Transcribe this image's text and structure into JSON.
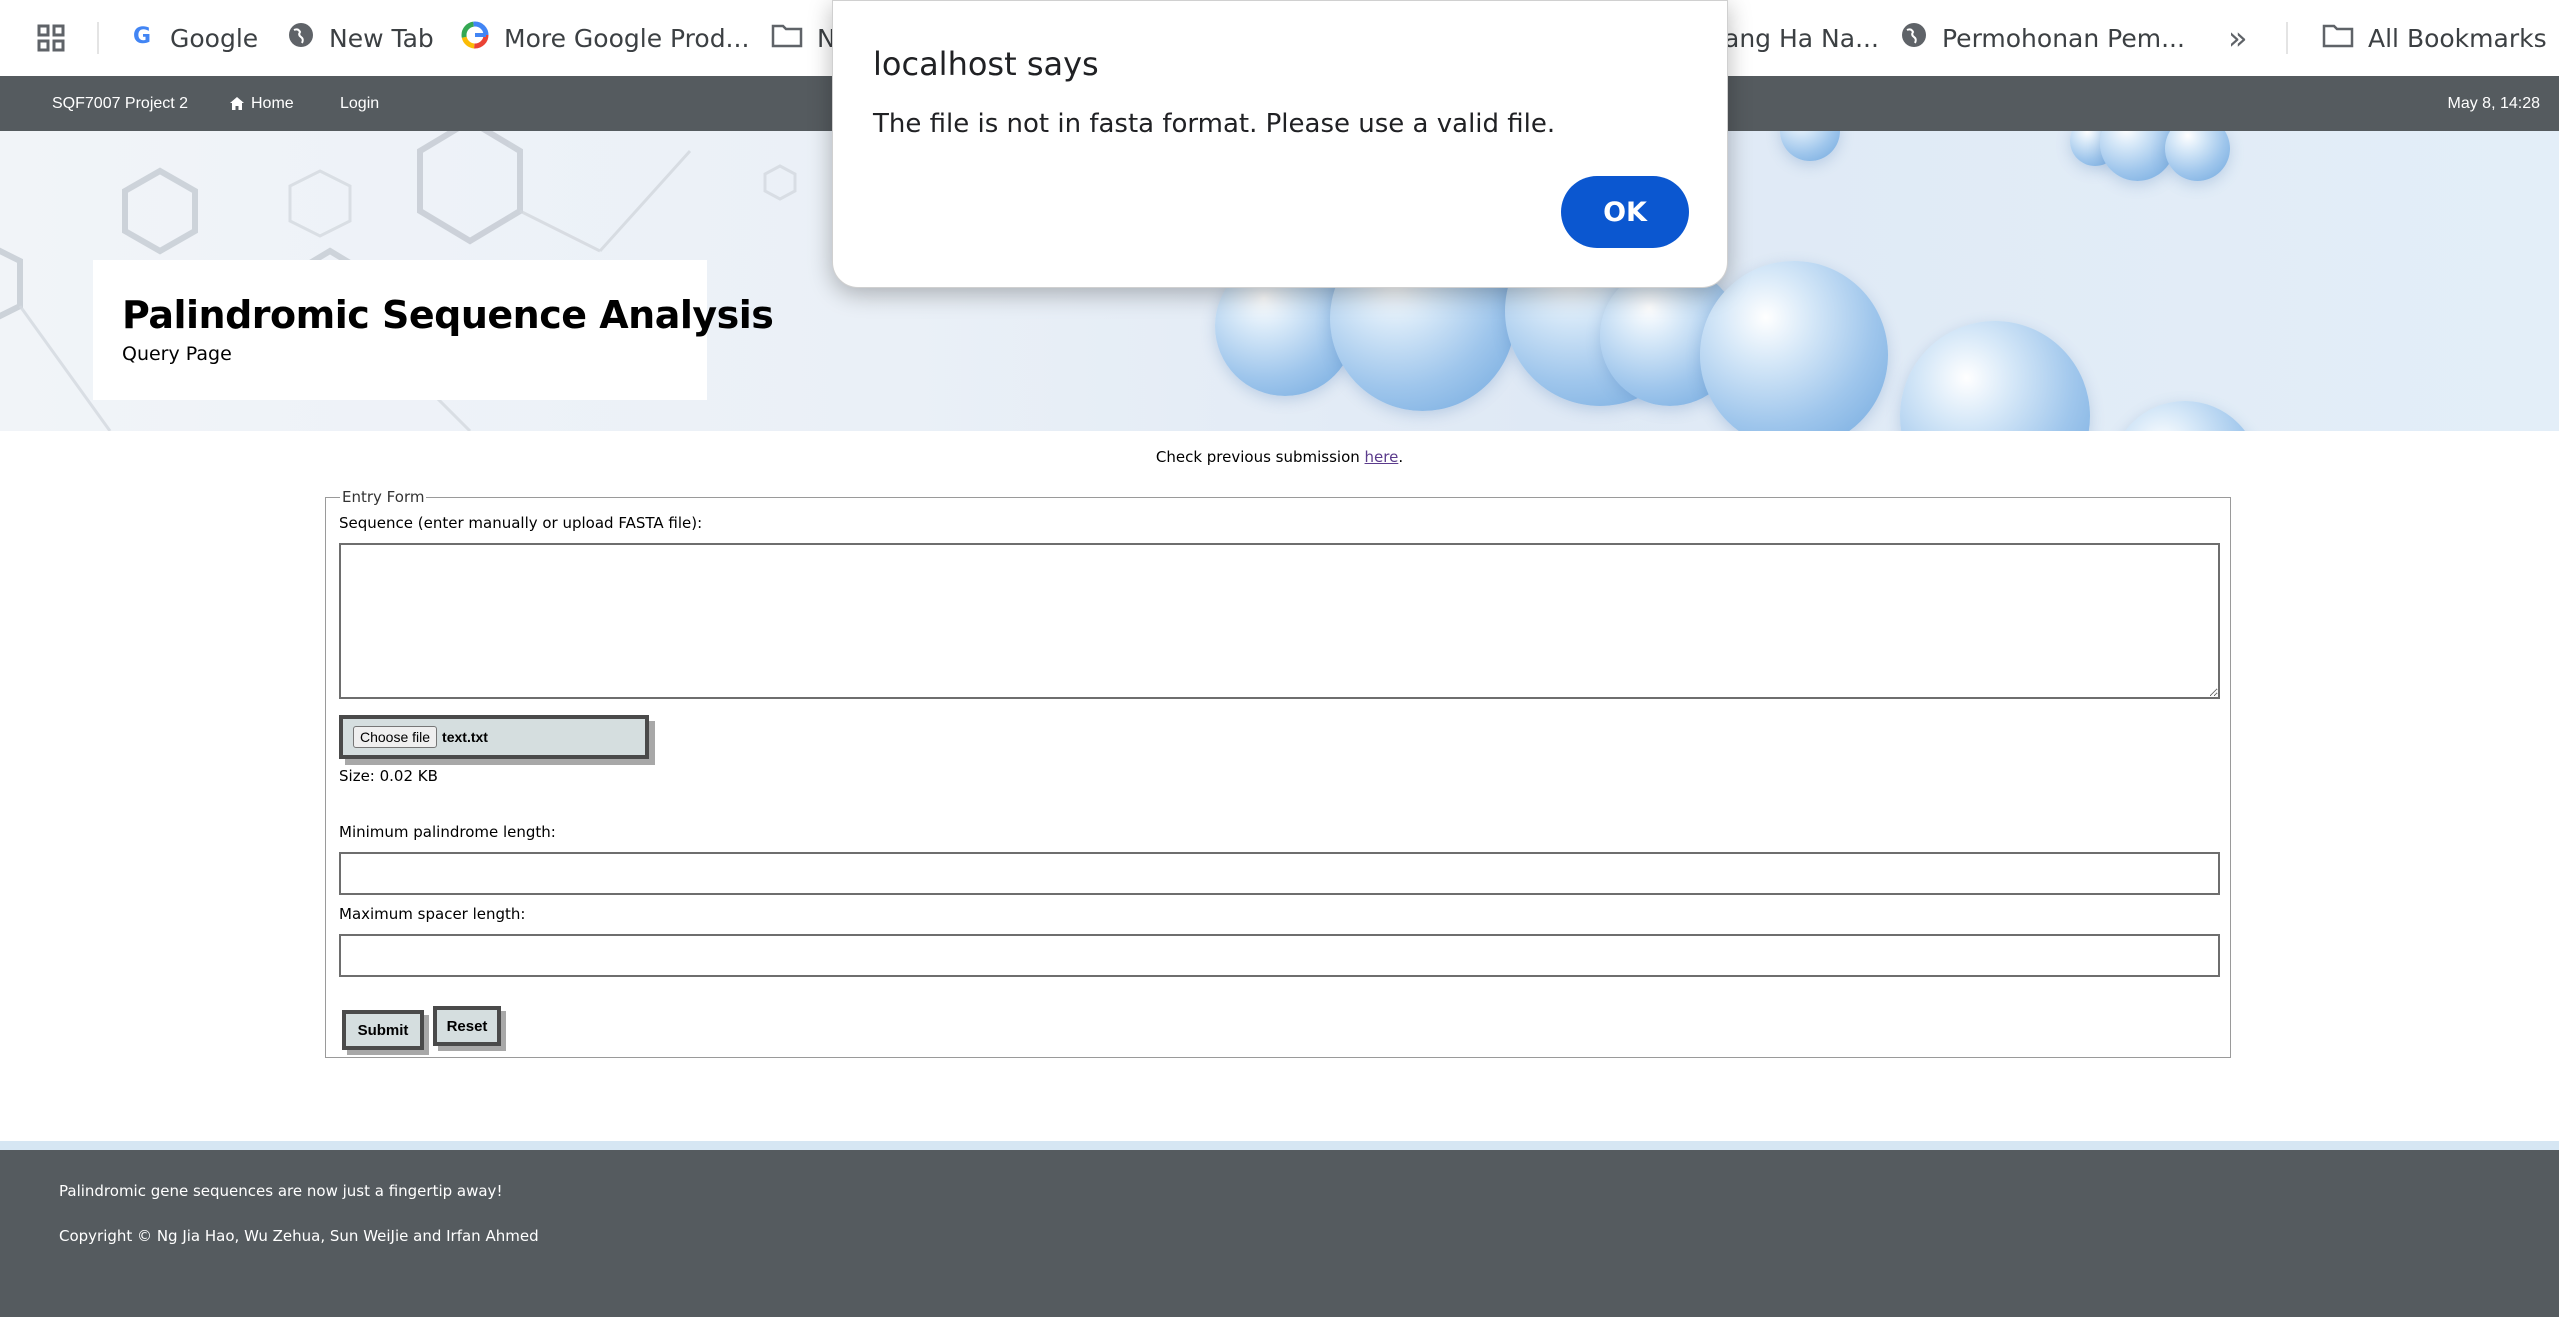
{
  "bookmarks_bar": {
    "items": [
      {
        "label": "Google",
        "icon": "google-icon"
      },
      {
        "label": "New Tab",
        "icon": "globe-icon"
      },
      {
        "label": "More Google Prod...",
        "icon": "google-icon"
      },
      {
        "label": "N",
        "icon": "folder-icon"
      },
      {
        "label": "ang Ha Na...",
        "icon": ""
      },
      {
        "label": "Permohonan Pem...",
        "icon": "globe-icon"
      }
    ],
    "overflow_label": "»",
    "all_bookmarks_label": "All Bookmarks"
  },
  "navbar": {
    "brand": "SQF7007 Project 2",
    "home": "Home",
    "login": "Login",
    "datetime": "May 8, 14:28"
  },
  "hero": {
    "title": "Palindromic Sequence Analysis",
    "subtitle": "Query Page"
  },
  "check": {
    "text": "Check previous submission ",
    "link": "here",
    "suffix": "."
  },
  "form": {
    "legend": "Entry Form",
    "sequence_label": "Sequence (enter manually or upload FASTA file):",
    "sequence_value": "",
    "file_button": "Choose file",
    "file_name": "text.txt",
    "file_size": "Size: 0.02 KB",
    "min_label": "Minimum palindrome length:",
    "min_value": "",
    "max_label": "Maximum spacer length:",
    "max_value": "",
    "submit": "Submit",
    "reset": "Reset"
  },
  "footer": {
    "tagline": "Palindromic gene sequences are now just a fingertip away!",
    "copyright": "Copyright © Ng Jia Hao, Wu Zehua, Sun WeiJie and Irfan Ahmed"
  },
  "dialog": {
    "title": "localhost says",
    "message": "The file is not in fasta format. Please use a valid file.",
    "ok": "OK"
  },
  "colors": {
    "navbar": "#555b5f",
    "dialog_button": "#0b57d0",
    "link": "#5b3b8c"
  }
}
